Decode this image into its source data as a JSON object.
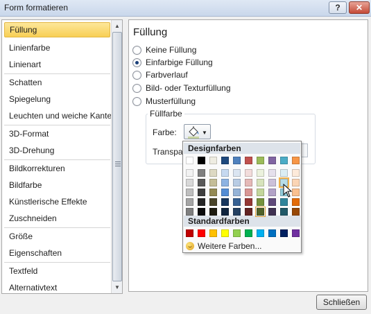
{
  "window": {
    "title": "Form formatieren",
    "help_label": "?",
    "close_label": "✕"
  },
  "nav": {
    "items": [
      {
        "label": "Füllung",
        "selected": true
      },
      {
        "label": "Linienfarbe"
      },
      {
        "label": "Linienart"
      },
      {
        "label": "Schatten"
      },
      {
        "label": "Spiegelung"
      },
      {
        "label": "Leuchten und weiche Kanten"
      },
      {
        "label": "3D-Format"
      },
      {
        "label": "3D-Drehung"
      },
      {
        "label": "Bildkorrekturen"
      },
      {
        "label": "Bildfarbe"
      },
      {
        "label": "Künstlerische Effekte"
      },
      {
        "label": "Zuschneiden"
      },
      {
        "label": "Größe"
      },
      {
        "label": "Eigenschaften"
      },
      {
        "label": "Textfeld"
      },
      {
        "label": "Alternativtext"
      }
    ]
  },
  "panel": {
    "title": "Füllung",
    "options": [
      {
        "label": "Keine Füllung",
        "checked": false
      },
      {
        "label": "Einfarbige Füllung",
        "checked": true
      },
      {
        "label": "Farbverlauf",
        "checked": false
      },
      {
        "label": "Bild- oder Texturfüllung",
        "checked": false
      },
      {
        "label": "Musterfüllung",
        "checked": false
      }
    ],
    "group_title": "Füllfarbe",
    "color_label": "Farbe:",
    "transparency_label": "Transpar",
    "color_icon": "paint-bucket-icon",
    "color_value": "#c7d3a2"
  },
  "palette": {
    "theme_header": "Designfarben",
    "standard_header": "Standardfarben",
    "more_label": "Weitere Farben...",
    "theme_rows": [
      [
        "#ffffff",
        "#000000",
        "#eeece1",
        "#1f497d",
        "#4f81bd",
        "#c0504d",
        "#9bbb59",
        "#8064a2",
        "#4bacc6",
        "#f79646"
      ],
      [
        "#f2f2f2",
        "#7f7f7f",
        "#ddd9c3",
        "#c6d9f0",
        "#dbe5f1",
        "#f2dcdb",
        "#ebf1dd",
        "#e5e0ec",
        "#dbeef3",
        "#fdeada"
      ],
      [
        "#d8d8d8",
        "#595959",
        "#c4bd97",
        "#8db3e2",
        "#b8cce4",
        "#e5b9b7",
        "#d7e3bc",
        "#ccc1d9",
        "#b7dde8",
        "#fbd5b5"
      ],
      [
        "#bfbfbf",
        "#3f3f3f",
        "#938953",
        "#548dd4",
        "#95b3d7",
        "#d99694",
        "#c3d69b",
        "#b2a2c7",
        "#92cddc",
        "#fac08f"
      ],
      [
        "#a5a5a5",
        "#262626",
        "#494429",
        "#17365d",
        "#366092",
        "#953734",
        "#76923c",
        "#5f497a",
        "#31859b",
        "#e36c09"
      ],
      [
        "#7f7f7f",
        "#0c0c0c",
        "#1d1b10",
        "#0f243e",
        "#244061",
        "#632423",
        "#4f6128",
        "#3f3151",
        "#205867",
        "#974806"
      ]
    ],
    "standard_row": [
      "#c00000",
      "#ff0000",
      "#ffc000",
      "#ffff00",
      "#92d050",
      "#00b050",
      "#00b0f0",
      "#0070c0",
      "#002060",
      "#7030a0"
    ],
    "selected_color": "#4f6128",
    "hovered_color": "#b7dde8"
  },
  "footer": {
    "close_button": "Schließen"
  }
}
